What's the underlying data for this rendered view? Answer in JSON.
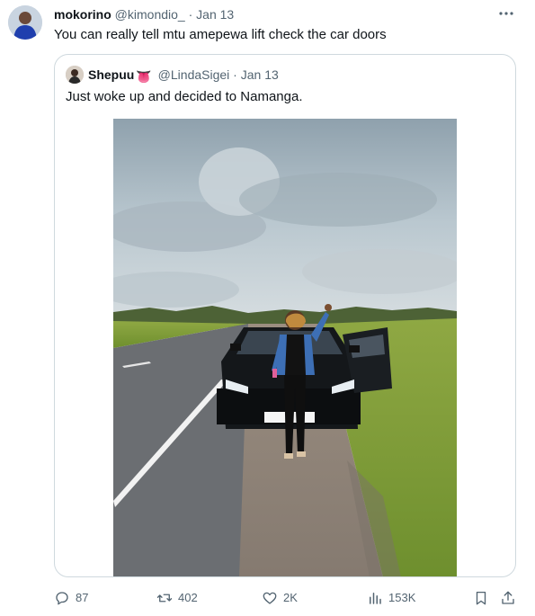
{
  "tweet": {
    "author_name": "mokorino",
    "author_handle": "@kimondio_",
    "separator": "·",
    "date": "Jan 13",
    "text": "You can really tell mtu amepewa lift check the car doors"
  },
  "quoted_tweet": {
    "author_name": "Shepuu",
    "author_emoji": "👅",
    "author_handle": "@LindaSigei",
    "separator": "·",
    "date": "Jan 13",
    "text": "Just woke up and decided to Namanga."
  },
  "actions": {
    "replies": "87",
    "retweets": "402",
    "likes": "2K",
    "views": "153K"
  },
  "colors": {
    "text_primary": "#0f1419",
    "text_secondary": "#536471",
    "border": "#cfd9de"
  },
  "icons": [
    "more-icon",
    "reply-icon",
    "retweet-icon",
    "like-icon",
    "views-icon",
    "bookmark-icon",
    "share-icon"
  ]
}
